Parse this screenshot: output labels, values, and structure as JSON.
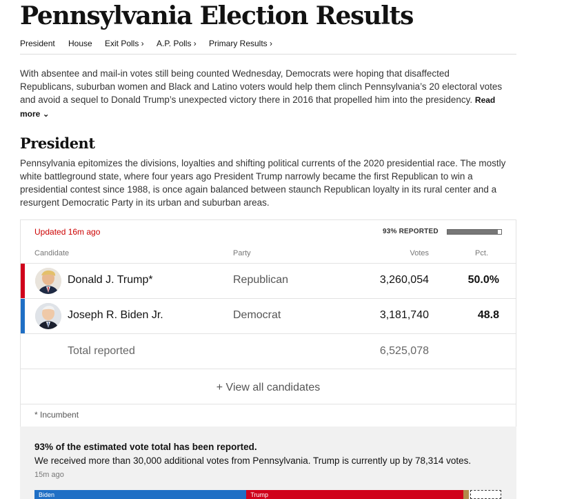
{
  "page_title": "Pennsylvania Election Results",
  "nav": [
    {
      "label": "President"
    },
    {
      "label": "House"
    },
    {
      "label": "Exit Polls ›"
    },
    {
      "label": "A.P. Polls ›"
    },
    {
      "label": "Primary Results ›"
    }
  ],
  "intro": {
    "text": "With absentee and mail-in votes still being counted Wednesday, Democrats were hoping that disaffected Republicans, suburban women and Black and Latino voters would help them clinch Pennsylvania’s 20 electoral votes and avoid a sequel to Donald Trump’s unexpected victory there in 2016 that propelled him into the presidency.",
    "read_more": "Read more ⌄"
  },
  "section": {
    "title": "President",
    "description": "Pennsylvania epitomizes the divisions, loyalties and shifting political currents of the 2020 presidential race. The mostly white battleground state, where four years ago President Trump narrowly became the first Republican to win a presidential contest since 1988, is once again balanced between staunch Republican loyalty in its rural center and a resurgent Democratic Party in its urban and suburban areas."
  },
  "results": {
    "updated": "Updated 16m ago",
    "reported_label": "93% REPORTED",
    "reported_fraction": 0.93,
    "columns": {
      "candidate": "Candidate",
      "party": "Party",
      "votes": "Votes",
      "pct": "Pct."
    },
    "candidates": [
      {
        "name": "Donald J. Trump*",
        "party": "Republican",
        "votes": "3,260,054",
        "pct": "50.0%",
        "color": "#d0021b"
      },
      {
        "name": "Joseph R. Biden Jr.",
        "party": "Democrat",
        "votes": "3,181,740",
        "pct": "48.8",
        "color": "#1f6fc5"
      }
    ],
    "total_label": "Total reported",
    "total_votes": "6,525,078",
    "view_all": "+ View all candidates",
    "incumbent_note": "* Incumbent"
  },
  "estimate": {
    "headline": "93% of the estimated vote total has been reported.",
    "body": "We received more than 30,000 additional votes from Pennsylvania. Trump is currently up by 78,314 votes.",
    "time": "15m ago",
    "bar": [
      {
        "label": "Biden",
        "share": 0.454,
        "color": "#1f6fc5"
      },
      {
        "label": "Trump",
        "share": 0.465,
        "color": "#d0021b"
      },
      {
        "label": "",
        "share": 0.012,
        "color": "#b38a4a"
      }
    ]
  }
}
